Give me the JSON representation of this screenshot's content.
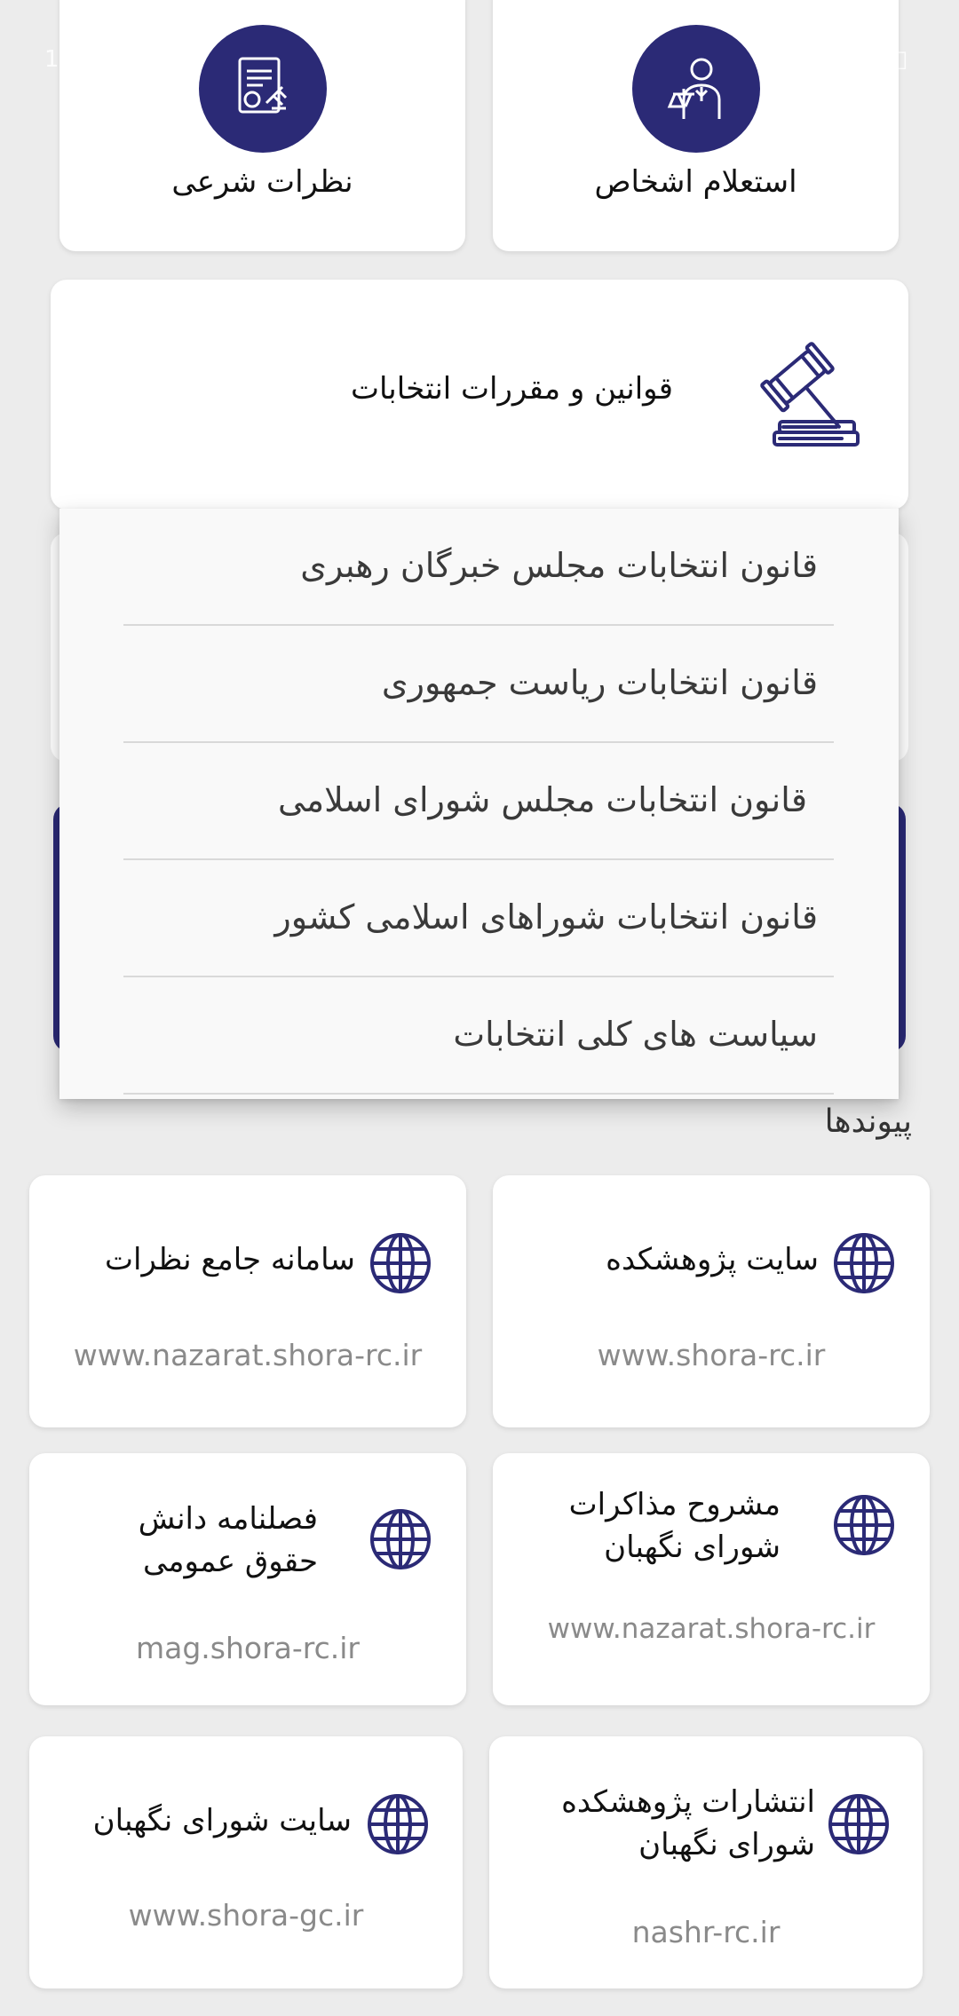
{
  "top_cards": {
    "left": {
      "label": "نظرات شرعی",
      "icon": "legal-document-icon"
    },
    "right": {
      "label": "استعلام اشخاص",
      "icon": "lawyer-person-icon"
    }
  },
  "laws_card": {
    "title": "قوانین و مقررات انتخابات",
    "icon": "gavel-icon"
  },
  "dropdown": {
    "items": [
      "قانون انتخابات مجلس خبرگان رهبری",
      "قانون انتخابات ریاست جمهوری",
      "قانون انتخابات مجلس شورای اسلامی",
      "قانون انتخابات شوراهای اسلامی کشور",
      "سیاست های کلی انتخابات"
    ]
  },
  "links": {
    "section_title": "پیوندها",
    "items": [
      {
        "title": "سایت پژوهشکده",
        "url": "www.shora-rc.ir"
      },
      {
        "title": "سامانه جامع نظرات",
        "url": "www.nazarat.shora-rc.ir"
      },
      {
        "title_line1": "مشروح مذاکرات",
        "title_line2": "شورای نگهبان",
        "url": "www.nazarat.shora-rc.ir"
      },
      {
        "title_line1": "فصلنامه دانش",
        "title_line2": "حقوق عمومی",
        "url": "mag.shora-rc.ir"
      },
      {
        "title_line1": "انتشارات پژوهشکده",
        "title_line2": "شورای نگهبان",
        "url": "nashr-rc.ir"
      },
      {
        "title": "سایت شورای نگهبان",
        "url": "www.shora-gc.ir"
      }
    ]
  },
  "colors": {
    "accent": "#2b2a76",
    "background": "#ececec",
    "card": "#ffffff"
  }
}
